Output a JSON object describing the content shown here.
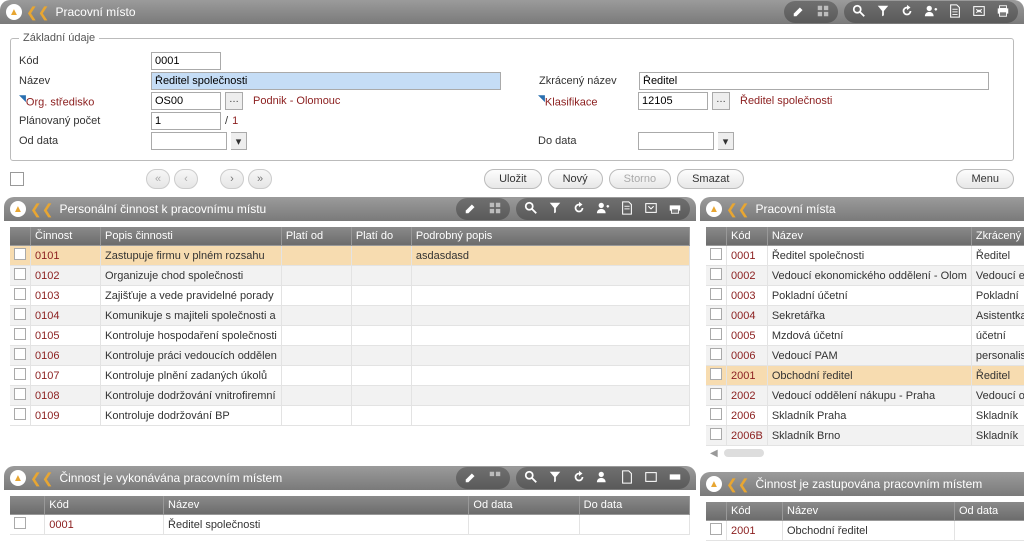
{
  "main_header": {
    "title": "Pracovní místo"
  },
  "form": {
    "legend": "Základní údaje",
    "kod": {
      "label": "Kód",
      "value": "0001"
    },
    "nazev": {
      "label": "Název",
      "value": "Ředitel společnosti"
    },
    "zkraceny": {
      "label": "Zkrácený název",
      "value": "Ředitel"
    },
    "org": {
      "label": "Org. středisko",
      "value": "OS00",
      "resolved": "Podnik - Olomouc"
    },
    "klas": {
      "label": "Klasifikace",
      "value": "12105",
      "resolved": "Ředitel společnosti"
    },
    "planovany": {
      "label": "Plánovaný počet",
      "value": "1",
      "count": "1"
    },
    "oddata": {
      "label": "Od data",
      "value": ""
    },
    "dodata": {
      "label": "Do data",
      "value": ""
    }
  },
  "actions": {
    "ulozit": "Uložit",
    "novy": "Nový",
    "storno": "Storno",
    "smazat": "Smazat",
    "menu": "Menu"
  },
  "panel_cinnost": {
    "title": "Personální činnost k pracovnímu místu",
    "headers": {
      "cinnost": "Činnost",
      "popis": "Popis činnosti",
      "plati_od": "Platí od",
      "plati_do": "Platí do",
      "podrobny": "Podrobný popis"
    },
    "rows": [
      {
        "c": "0101",
        "p": "Zastupuje firmu v plném rozsahu",
        "od": "",
        "do": "",
        "pp": "asdasdasd",
        "hl": true
      },
      {
        "c": "0102",
        "p": "Organizuje chod společnosti",
        "od": "",
        "do": "",
        "pp": ""
      },
      {
        "c": "0103",
        "p": "Zajišťuje a vede pravidelné porady",
        "od": "",
        "do": "",
        "pp": ""
      },
      {
        "c": "0104",
        "p": "Komunikuje s majiteli společnosti a",
        "od": "",
        "do": "",
        "pp": ""
      },
      {
        "c": "0105",
        "p": "Kontroluje hospodaření společnosti",
        "od": "",
        "do": "",
        "pp": ""
      },
      {
        "c": "0106",
        "p": "Kontroluje práci vedoucích oddělen",
        "od": "",
        "do": "",
        "pp": ""
      },
      {
        "c": "0107",
        "p": "Kontroluje plnění zadaných úkolů",
        "od": "",
        "do": "",
        "pp": ""
      },
      {
        "c": "0108",
        "p": "Kontroluje dodržování vnitrofiremní",
        "od": "",
        "do": "",
        "pp": ""
      },
      {
        "c": "0109",
        "p": "Kontroluje dodržování BP",
        "od": "",
        "do": "",
        "pp": ""
      }
    ]
  },
  "panel_mista": {
    "title": "Pracovní místa",
    "headers": {
      "kod": "Kód",
      "nazev": "Název",
      "zkr": "Zkrácený náze"
    },
    "rows": [
      {
        "k": "0001",
        "n": "Ředitel společnosti",
        "z": "Ředitel"
      },
      {
        "k": "0002",
        "n": "Vedoucí ekonomického oddělení - Olom",
        "z": "Vedoucí ekonom"
      },
      {
        "k": "0003",
        "n": "Pokladní účetní",
        "z": "Pokladní"
      },
      {
        "k": "0004",
        "n": "Sekretářka",
        "z": "Asistentka"
      },
      {
        "k": "0005",
        "n": "Mzdová účetní",
        "z": "účetní"
      },
      {
        "k": "0006",
        "n": "Vedoucí PAM",
        "z": "personalista"
      },
      {
        "k": "2001",
        "n": "Obchodní ředitel",
        "z": "Ředitel",
        "hl": true
      },
      {
        "k": "2002",
        "n": "Vedoucí oddělení nákupu - Praha",
        "z": "Vedoucí odděle"
      },
      {
        "k": "2006",
        "n": "Skladník Praha",
        "z": "Skladník"
      },
      {
        "k": "2006B",
        "n": "Skladník Brno",
        "z": "Skladník"
      }
    ]
  },
  "panel_vykon": {
    "title": "Činnost je vykonávána pracovním místem",
    "headers": {
      "kod": "Kód",
      "nazev": "Název",
      "od": "Od data",
      "do": "Do data"
    },
    "rows": [
      {
        "k": "0001",
        "n": "Ředitel společnosti",
        "od": "",
        "do": ""
      }
    ]
  },
  "panel_zast": {
    "title": "Činnost je zastupována pracovním místem",
    "headers": {
      "kod": "Kód",
      "nazev": "Název",
      "od": "Od data"
    },
    "rows": [
      {
        "k": "2001",
        "n": "Obchodní ředitel",
        "od": ""
      }
    ]
  }
}
